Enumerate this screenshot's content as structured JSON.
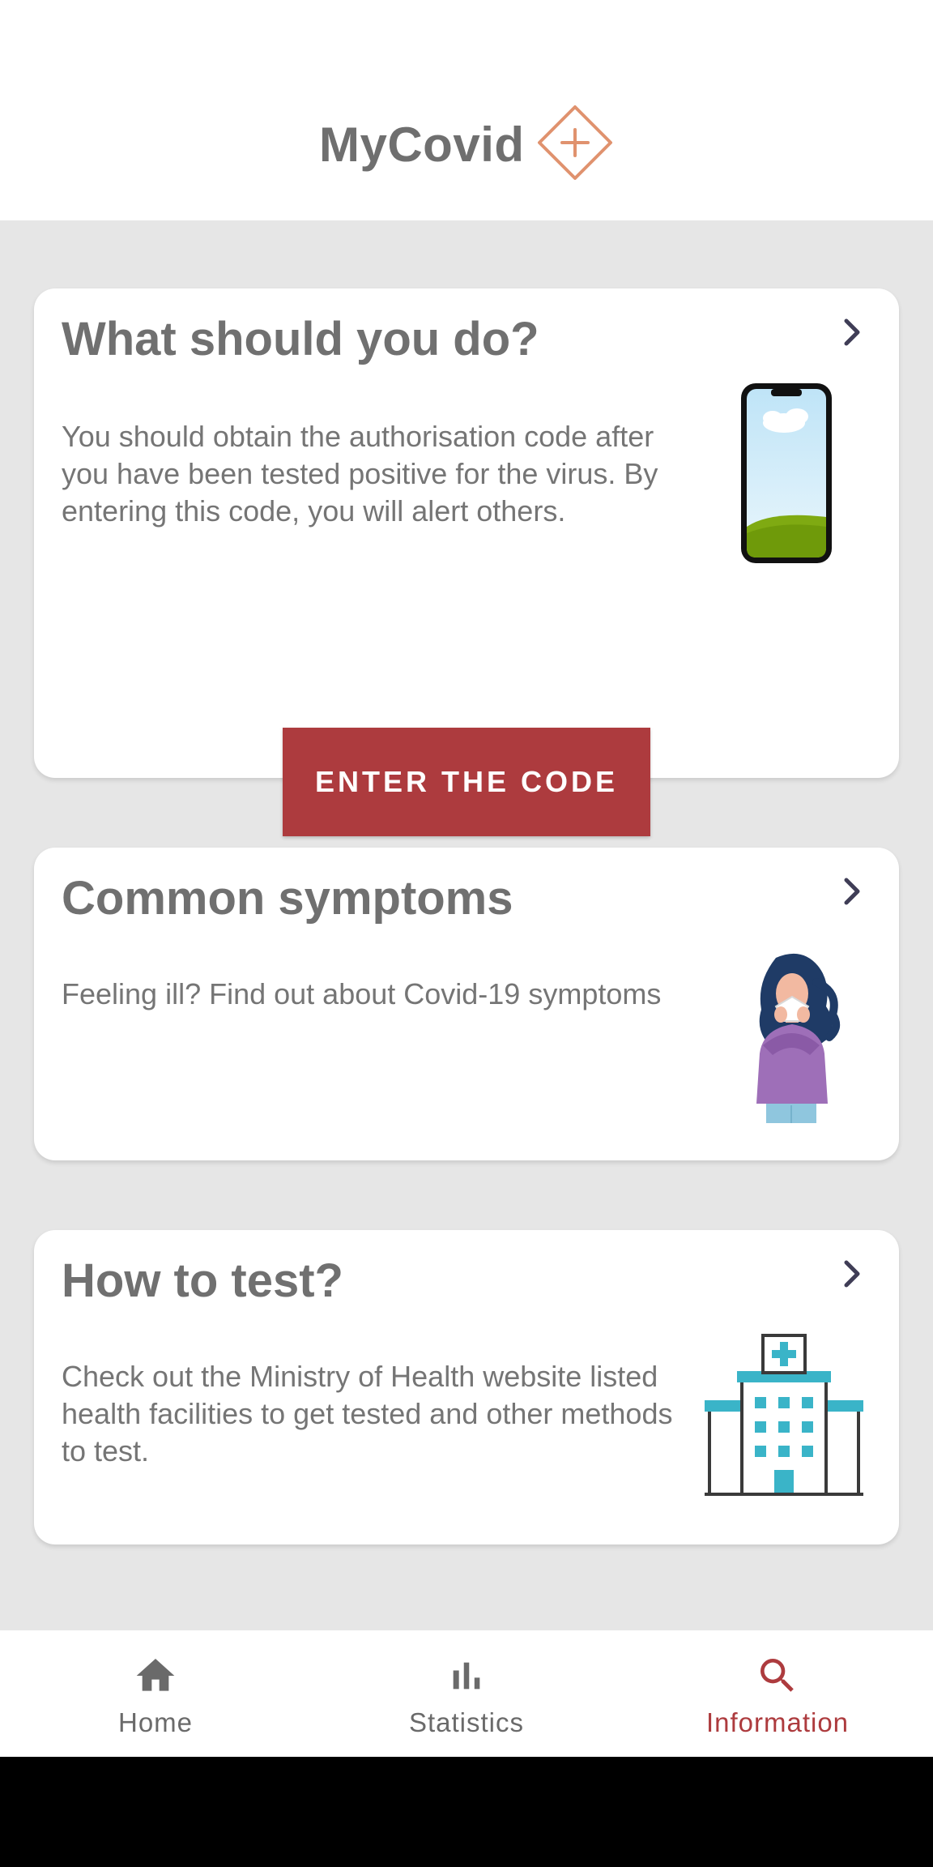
{
  "header": {
    "title": "MyCovid",
    "logo_icon": "diamond-plus-icon",
    "logo_color": "#e0926e"
  },
  "cards": [
    {
      "title": "What should you do?",
      "body": "You should obtain the authorisation code after you have been tested positive for the virus. By entering this code, you will alert others.",
      "illustration": "smartphone-illustration",
      "button_label": "ENTER THE CODE"
    },
    {
      "title": "Common symptoms",
      "body": "Feeling ill? Find out about Covid-19 symptoms",
      "illustration": "sneezing-woman-illustration"
    },
    {
      "title": "How to test?",
      "body": "Check out the Ministry of Health website listed health facilities to get tested and other methods to test.",
      "illustration": "hospital-illustration"
    }
  ],
  "nav": {
    "items": [
      {
        "label": "Home",
        "icon": "home-icon",
        "active": false
      },
      {
        "label": "Statistics",
        "icon": "bar-chart-icon",
        "active": false
      },
      {
        "label": "Information",
        "icon": "search-icon",
        "active": true
      }
    ]
  },
  "colors": {
    "accent": "#ad3b3e",
    "background": "#e6e6e6",
    "card": "#ffffff",
    "text": "#707070",
    "chevron": "#3f3d56"
  }
}
